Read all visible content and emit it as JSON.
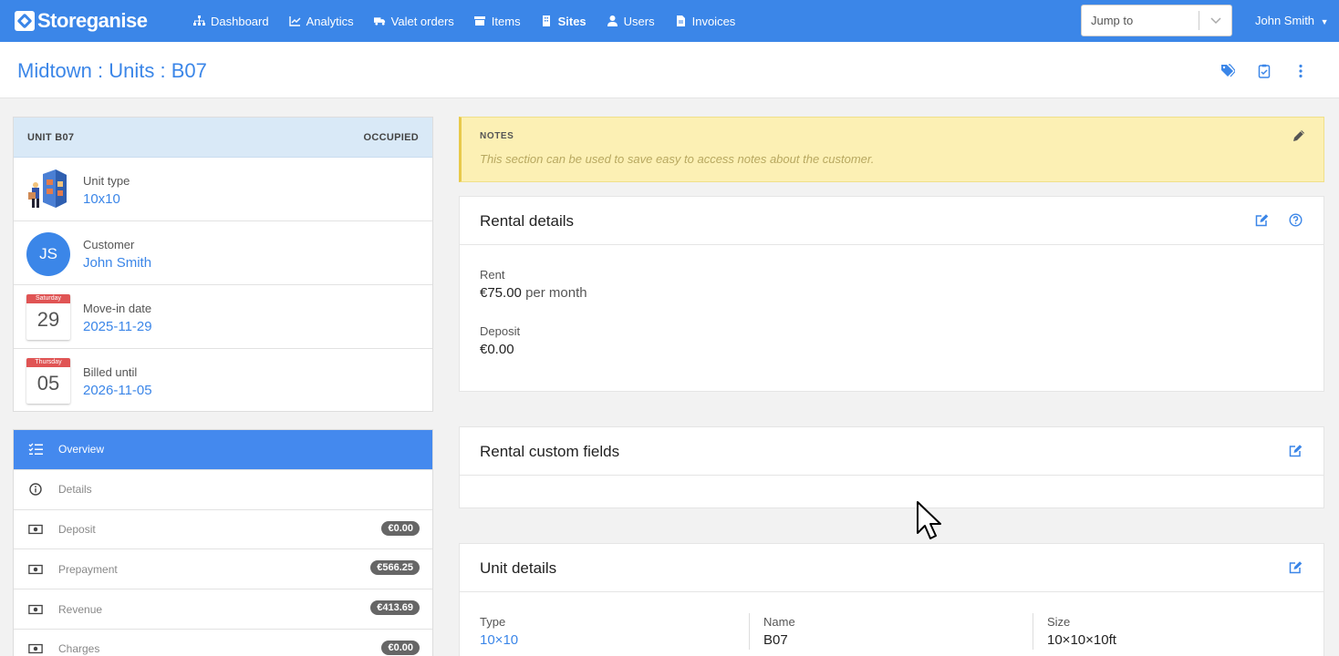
{
  "nav": {
    "brand": "Storeganise",
    "items": [
      {
        "label": "Dashboard",
        "icon": "sitemap-icon"
      },
      {
        "label": "Analytics",
        "icon": "chart-icon"
      },
      {
        "label": "Valet orders",
        "icon": "truck-icon"
      },
      {
        "label": "Items",
        "icon": "box-icon"
      },
      {
        "label": "Sites",
        "icon": "building-icon"
      },
      {
        "label": "Users",
        "icon": "user-icon"
      },
      {
        "label": "Invoices",
        "icon": "file-icon"
      }
    ],
    "active": "Sites",
    "jump_placeholder": "Jump to",
    "user": "John Smith"
  },
  "header": {
    "title": "Midtown : Units : B07"
  },
  "unit_card": {
    "title": "UNIT B07",
    "status": "OCCUPIED",
    "unit_type_label": "Unit type",
    "unit_type_value": "10x10",
    "customer_label": "Customer",
    "customer_initials": "JS",
    "customer_value": "John Smith",
    "move_in_label": "Move-in date",
    "move_in_day": "Saturday",
    "move_in_num": "29",
    "move_in_value": "2025-11-29",
    "billed_label": "Billed until",
    "billed_day": "Thursday",
    "billed_num": "05",
    "billed_value": "2026-11-05"
  },
  "side_menu": [
    {
      "label": "Overview",
      "icon": "list-check-icon",
      "badge": ""
    },
    {
      "label": "Details",
      "icon": "info-icon",
      "badge": ""
    },
    {
      "label": "Deposit",
      "icon": "money-icon",
      "badge": "€0.00"
    },
    {
      "label": "Prepayment",
      "icon": "money-icon",
      "badge": "€566.25"
    },
    {
      "label": "Revenue",
      "icon": "money-icon",
      "badge": "€413.69"
    },
    {
      "label": "Charges",
      "icon": "money-icon",
      "badge": "€0.00"
    }
  ],
  "notes": {
    "title": "NOTES",
    "text": "This section can be used to save easy to access notes about the customer."
  },
  "rental_details": {
    "title": "Rental details",
    "rent_label": "Rent",
    "rent_value": "€75.00",
    "rent_period": "per month",
    "deposit_label": "Deposit",
    "deposit_value": "€0.00"
  },
  "rental_custom": {
    "title": "Rental custom fields"
  },
  "unit_details": {
    "title": "Unit details",
    "type_label": "Type",
    "type_value": "10×10",
    "name_label": "Name",
    "name_value": "B07",
    "size_label": "Size",
    "size_value": "10×10×10ft"
  },
  "colors": {
    "primary": "#3b86e8",
    "notes_bg": "#fcf0b4",
    "badge": "#666666",
    "calendar_red": "#e05454"
  }
}
